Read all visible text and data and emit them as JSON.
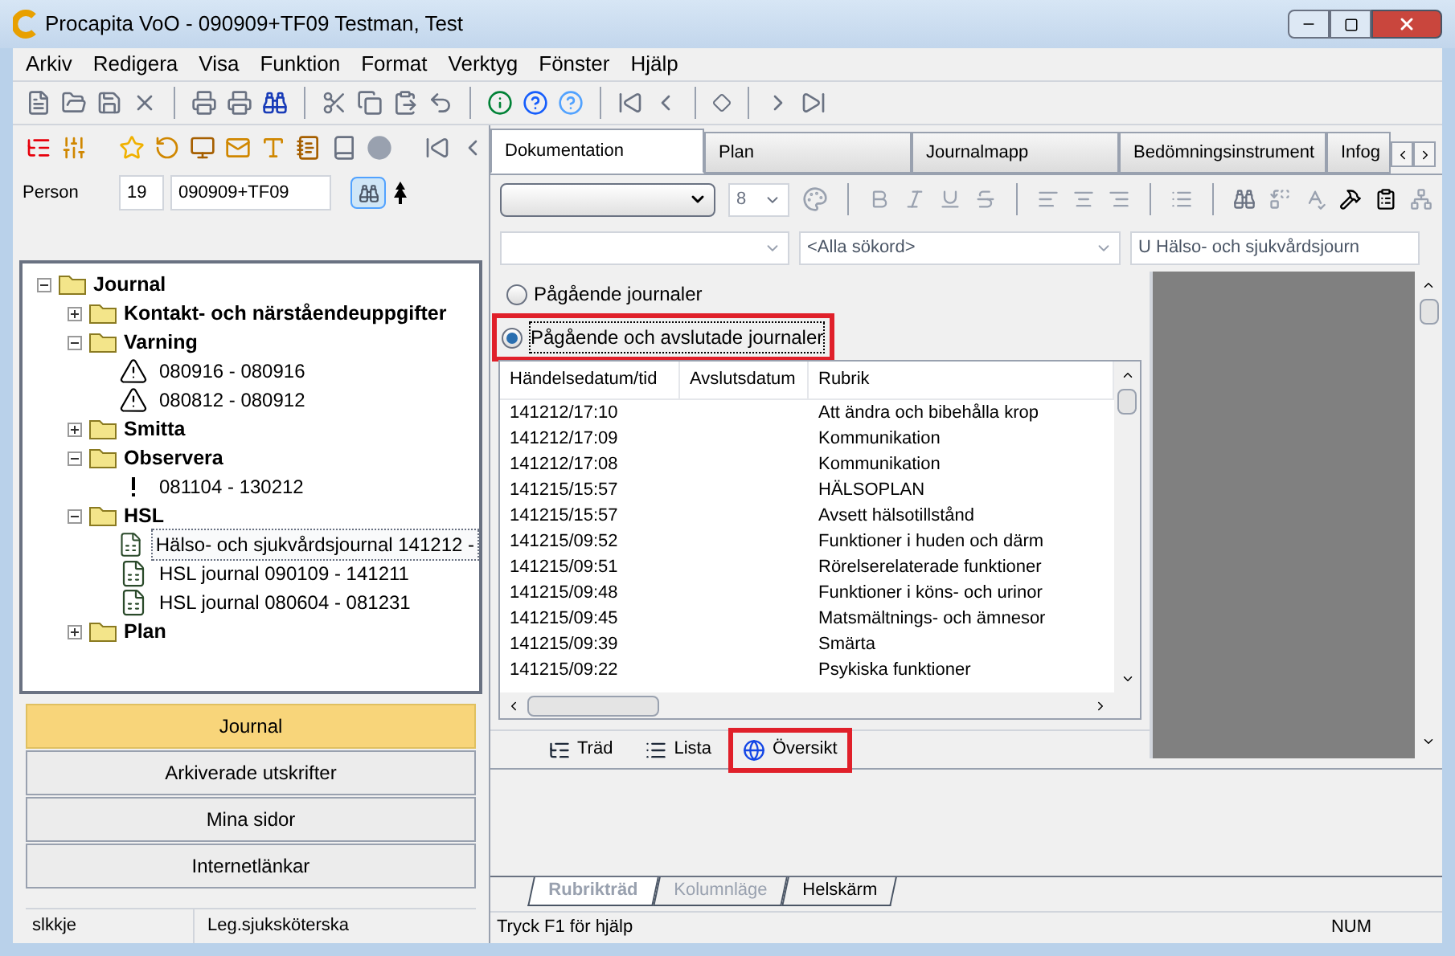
{
  "window": {
    "title": "Procapita VoO - 090909+TF09 Testman, Test"
  },
  "menu": [
    "Arkiv",
    "Redigera",
    "Visa",
    "Funktion",
    "Format",
    "Verktyg",
    "Fönster",
    "Hjälp"
  ],
  "person": {
    "label": "Person",
    "number": "19",
    "id": "090909+TF09"
  },
  "tree": [
    {
      "label": "Journal",
      "kind": "folder",
      "expanded": true,
      "children": [
        {
          "label": "Kontakt- och närståendeuppgifter",
          "kind": "folder",
          "expanded": false
        },
        {
          "label": "Varning",
          "kind": "folder",
          "expanded": true,
          "children": [
            {
              "label": "080916 - 080916",
              "kind": "warning",
              "selected": false
            },
            {
              "label": "080812 - 080912",
              "kind": "warning",
              "selected": false
            }
          ]
        },
        {
          "label": "Smitta",
          "kind": "folder",
          "expanded": false
        },
        {
          "label": "Observera",
          "kind": "folder",
          "expanded": true,
          "children": [
            {
              "label": "081104 - 130212",
              "kind": "note",
              "selected": false
            }
          ]
        },
        {
          "label": "HSL",
          "kind": "folder",
          "expanded": true,
          "children": [
            {
              "label": "Hälso- och sjukvårdsjournal 141212 -",
              "kind": "document",
              "selected": true
            },
            {
              "label": "HSL journal 090109 - 141211",
              "kind": "document",
              "selected": false
            },
            {
              "label": "HSL journal 080604 - 081231",
              "kind": "document",
              "selected": false
            }
          ]
        },
        {
          "label": "Plan",
          "kind": "folder",
          "expanded": false
        }
      ]
    }
  ],
  "nav_buttons": [
    {
      "label": "Journal",
      "selected": true
    },
    {
      "label": "Arkiverade utskrifter",
      "selected": false
    },
    {
      "label": "Mina sidor",
      "selected": false
    },
    {
      "label": "Internetlänkar",
      "selected": false
    }
  ],
  "left_status": [
    "slkkje",
    "Leg.sjuksköterska"
  ],
  "tabs": [
    {
      "label": "Dokumentation",
      "selected": true
    },
    {
      "label": "Plan",
      "selected": false
    },
    {
      "label": "Journalmapp",
      "selected": false
    },
    {
      "label": "Bedömningsinstrument",
      "selected": false
    },
    {
      "label": "Infog",
      "selected": false
    }
  ],
  "format_toolbar": {
    "font_size": "8"
  },
  "search_row": {
    "keywords": "<Alla sökord>",
    "journal": "U Hälso- och sjukvårdsjourn"
  },
  "radio_options": [
    {
      "label": "Pågående journaler",
      "selected": false,
      "highlighted": false
    },
    {
      "label": "Pågående och avslutade journaler",
      "selected": true,
      "highlighted": true
    }
  ],
  "table": {
    "columns": [
      "Händelsedatum/tid",
      "Avslutsdatum",
      "Rubrik"
    ],
    "rows": [
      [
        "141212/17:10",
        "",
        "Att ändra och bibehålla krop"
      ],
      [
        "141212/17:09",
        "",
        "Kommunikation"
      ],
      [
        "141212/17:08",
        "",
        "Kommunikation"
      ],
      [
        "141215/15:57",
        "",
        "HÄLSOPLAN"
      ],
      [
        "141215/15:57",
        "",
        "Avsett hälsotillstånd"
      ],
      [
        "141215/09:52",
        "",
        "Funktioner i huden och därm"
      ],
      [
        "141215/09:51",
        "",
        "Rörelserelaterade funktioner"
      ],
      [
        "141215/09:48",
        "",
        "Funktioner i köns- och urinor"
      ],
      [
        "141215/09:45",
        "",
        "Matsmältnings- och ämnesor"
      ],
      [
        "141215/09:39",
        "",
        "Smärta"
      ],
      [
        "141215/09:22",
        "",
        "Psykiska funktioner"
      ]
    ]
  },
  "view_tabs": [
    {
      "label": "Träd",
      "kind": "tree",
      "highlighted": false
    },
    {
      "label": "Lista",
      "kind": "list",
      "highlighted": false
    },
    {
      "label": "Översikt",
      "kind": "overview",
      "highlighted": true
    }
  ],
  "bottom_tabs": [
    {
      "label": "Rubrikträd",
      "selected": true,
      "disabled": true
    },
    {
      "label": "Kolumnläge",
      "selected": false,
      "disabled": true
    },
    {
      "label": "Helskärm",
      "selected": false,
      "disabled": false
    }
  ],
  "status_bar": {
    "hint": "Tryck F1 för hjälp",
    "indicator": "NUM"
  }
}
